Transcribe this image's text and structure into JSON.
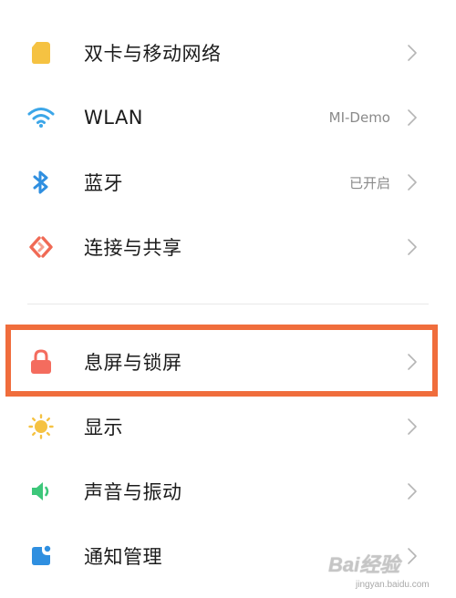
{
  "settings": {
    "items": [
      {
        "label": "双卡与移动网络",
        "value": "",
        "icon": "sim-card-icon",
        "icon_color": "#F5C242"
      },
      {
        "label": "WLAN",
        "value": "MI-Demo",
        "icon": "wifi-icon",
        "icon_color": "#3CA6E8"
      },
      {
        "label": "蓝牙",
        "value": "已开启",
        "icon": "bluetooth-icon",
        "icon_color": "#2F8FE0"
      },
      {
        "label": "连接与共享",
        "value": "",
        "icon": "connection-sharing-icon",
        "icon_color": "#F06A55"
      },
      {
        "label": "息屏与锁屏",
        "value": "",
        "icon": "lock-icon",
        "icon_color": "#F46C5E"
      },
      {
        "label": "显示",
        "value": "",
        "icon": "sun-icon",
        "icon_color": "#F5C242"
      },
      {
        "label": "声音与振动",
        "value": "",
        "icon": "speaker-icon",
        "icon_color": "#3DC77A"
      },
      {
        "label": "通知管理",
        "value": "",
        "icon": "notification-icon",
        "icon_color": "#2F8FE0"
      }
    ]
  },
  "highlight": {
    "color": "#F06D3C"
  },
  "watermark": {
    "line1": "Bai经验",
    "line2": "jingyan.baidu.com"
  }
}
